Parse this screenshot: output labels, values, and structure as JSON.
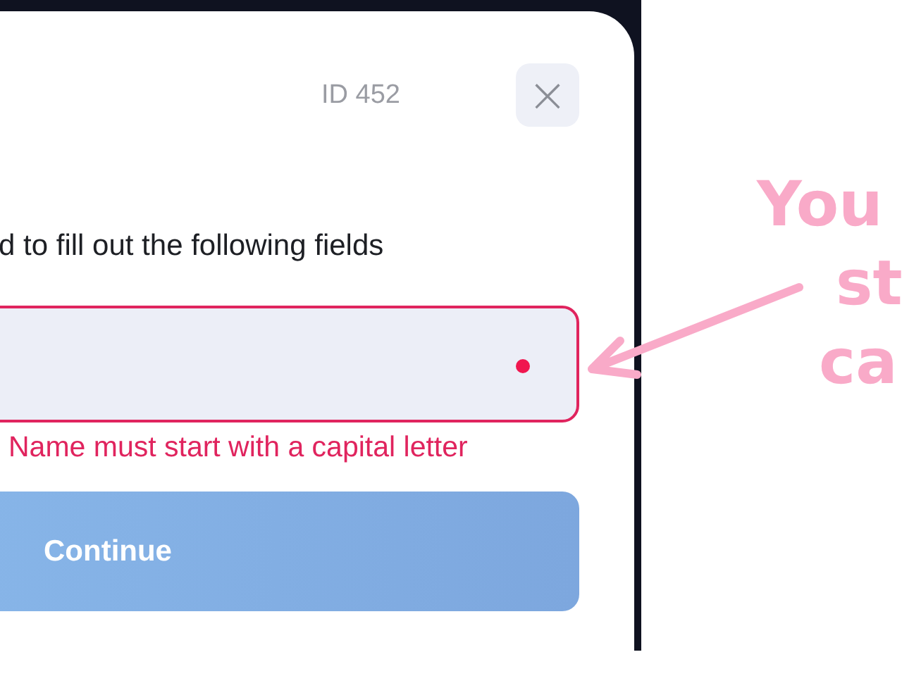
{
  "dialog": {
    "id_label": "ID 452",
    "close_button": {
      "label": "×"
    },
    "instruction": "d to fill out the following fields",
    "name_field": {
      "invalid": true,
      "error": "Name must start with a capital letter"
    },
    "continue_button": {
      "label": "Continue"
    }
  },
  "annotation": {
    "lines": [
      "You",
      "st",
      "ca"
    ]
  }
}
